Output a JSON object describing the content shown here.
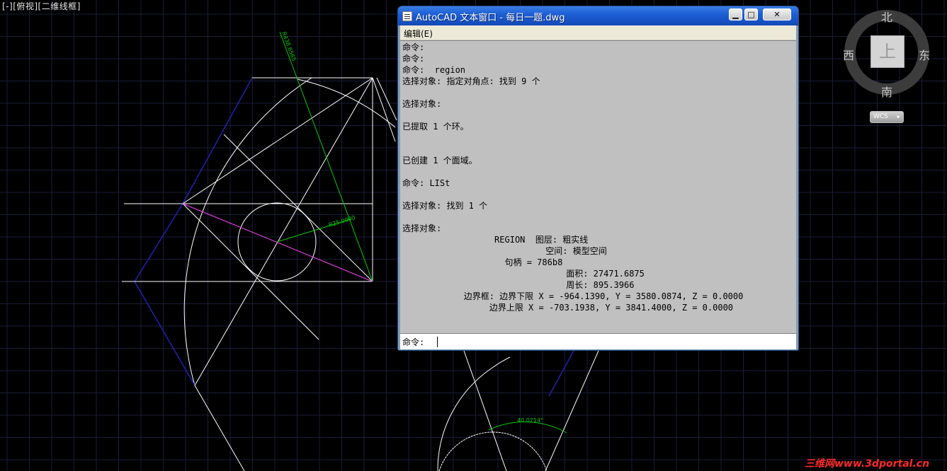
{
  "viewport": {
    "label": "[-][俯视][二维线框]"
  },
  "viewcube": {
    "north": "北",
    "south": "南",
    "east": "东",
    "west": "西",
    "top_face": "上",
    "wcs_label": "WCS"
  },
  "drawing": {
    "dim_radius_large": "R438.6565",
    "dim_radius_small": "R25.0000",
    "dim_angle": "40.0714°"
  },
  "text_window": {
    "title": "AutoCAD 文本窗口 - 每日一题.dwg",
    "menu_edit": "编辑(E)",
    "history": "命令:\n命令:\n命令:  region\n选择对象: 指定对角点: 找到 9 个\n\n选择对象:\n\n已提取 1 个环。\n\n\n已创建 1 个面域。\n\n命令: LISt\n\n选择对象: 找到 1 个\n\n选择对象:\n                  REGION  图层: 粗实线\n                            空间: 模型空间\n                    句柄 = 786b8\n                                面积: 27471.6875\n                                周长: 895.3966\n            边界框: 边界下限 X = -964.1390, Y = 3580.0874, Z = 0.0000\n                 边界上限 X = -703.1938, Y = 3841.4000, Z = 0.0000",
    "prompt": "命令:"
  },
  "watermark": "三维网www.3dportal.cn",
  "colors": {
    "background": "#000000",
    "grid": "#1a1d3a",
    "geometry": "#ffffff",
    "dimension": "#00cc00",
    "hidden_line": "#1a1aa0",
    "center_line": "#e020e0"
  }
}
